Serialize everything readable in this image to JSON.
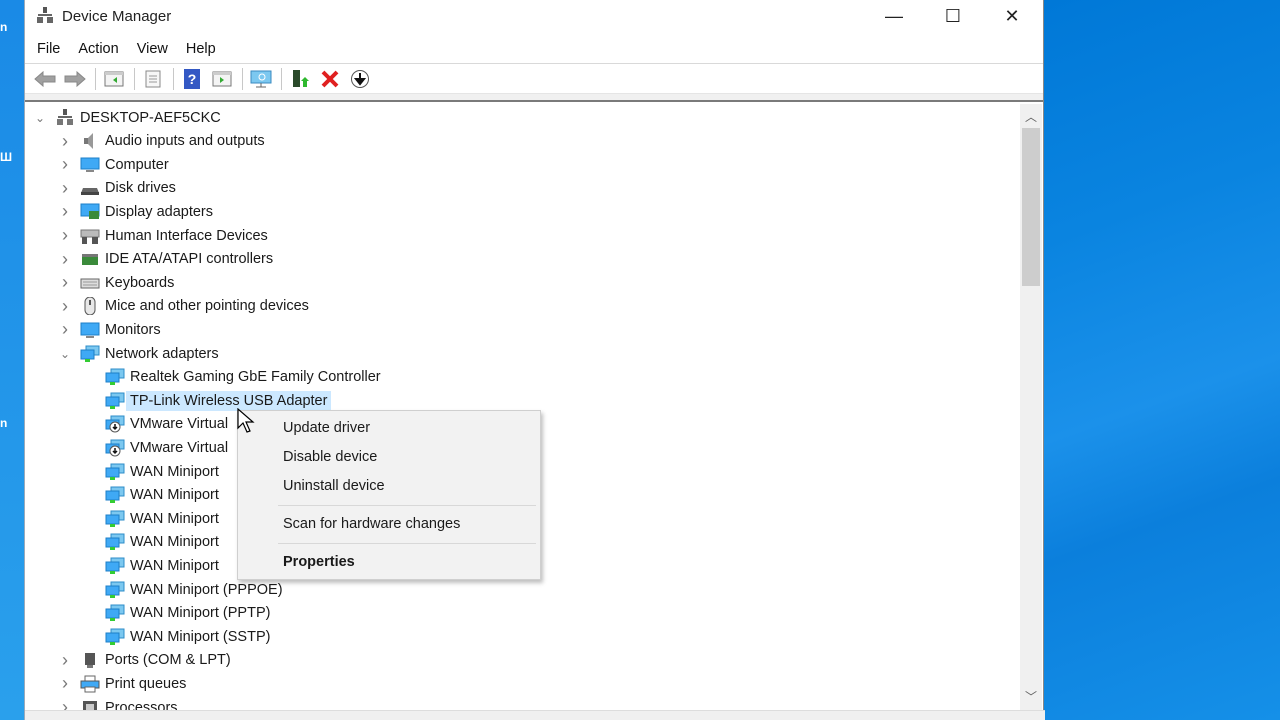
{
  "window": {
    "title": "Device Manager",
    "controls": {
      "minimize": "—",
      "maximize": "☐",
      "close": "✕"
    }
  },
  "menubar": [
    "File",
    "Action",
    "View",
    "Help"
  ],
  "toolbar": {
    "buttons": [
      "back-icon",
      "forward-icon",
      "show-hide-console-tree-icon",
      "properties-icon",
      "help-icon",
      "show-hide-action-pane-icon",
      "scan-hardware-icon",
      "update-driver-icon",
      "uninstall-icon",
      "disable-device-icon"
    ]
  },
  "tree": {
    "root": "DESKTOP-AEF5CKC",
    "categories": [
      {
        "label": "Audio inputs and outputs",
        "icon": "speaker-icon",
        "expanded": false
      },
      {
        "label": "Computer",
        "icon": "computer-icon",
        "expanded": false
      },
      {
        "label": "Disk drives",
        "icon": "disk-drive-icon",
        "expanded": false
      },
      {
        "label": "Display adapters",
        "icon": "display-adapter-icon",
        "expanded": false
      },
      {
        "label": "Human Interface Devices",
        "icon": "hid-icon",
        "expanded": false
      },
      {
        "label": "IDE ATA/ATAPI controllers",
        "icon": "ide-controller-icon",
        "expanded": false
      },
      {
        "label": "Keyboards",
        "icon": "keyboard-icon",
        "expanded": false
      },
      {
        "label": "Mice and other pointing devices",
        "icon": "mouse-icon",
        "expanded": false
      },
      {
        "label": "Monitors",
        "icon": "monitor-icon",
        "expanded": false
      },
      {
        "label": "Network adapters",
        "icon": "network-adapter-icon",
        "expanded": true
      }
    ],
    "network_adapters": [
      {
        "label": "Realtek Gaming GbE Family Controller",
        "icon": "network-adapter-icon"
      },
      {
        "label": "TP-Link Wireless USB Adapter",
        "icon": "network-adapter-icon",
        "selected": true
      },
      {
        "label": "VMware Virtual",
        "icon": "vmware-adapter-icon"
      },
      {
        "label": "VMware Virtual",
        "icon": "vmware-adapter-icon"
      },
      {
        "label": "WAN Miniport",
        "icon": "network-adapter-icon"
      },
      {
        "label": "WAN Miniport",
        "icon": "network-adapter-icon"
      },
      {
        "label": "WAN Miniport",
        "icon": "network-adapter-icon"
      },
      {
        "label": "WAN Miniport",
        "icon": "network-adapter-icon"
      },
      {
        "label": "WAN Miniport",
        "icon": "network-adapter-icon"
      },
      {
        "label": "WAN Miniport (PPPOE)",
        "icon": "network-adapter-icon"
      },
      {
        "label": "WAN Miniport (PPTP)",
        "icon": "network-adapter-icon"
      },
      {
        "label": "WAN Miniport (SSTP)",
        "icon": "network-adapter-icon"
      }
    ],
    "after": [
      {
        "label": "Ports (COM & LPT)",
        "icon": "port-icon",
        "expanded": false
      },
      {
        "label": "Print queues",
        "icon": "printer-icon",
        "expanded": false
      },
      {
        "label": "Processors",
        "icon": "processor-icon",
        "expanded": false
      }
    ]
  },
  "context_menu": {
    "items": [
      "Update driver",
      "Disable device",
      "Uninstall device",
      "Scan for hardware changes",
      "Properties"
    ]
  },
  "colors": {
    "selection": "#cce8ff",
    "desktop": "#0078d7",
    "uninstall_red": "#e02020",
    "help_blue": "#3358c4"
  }
}
